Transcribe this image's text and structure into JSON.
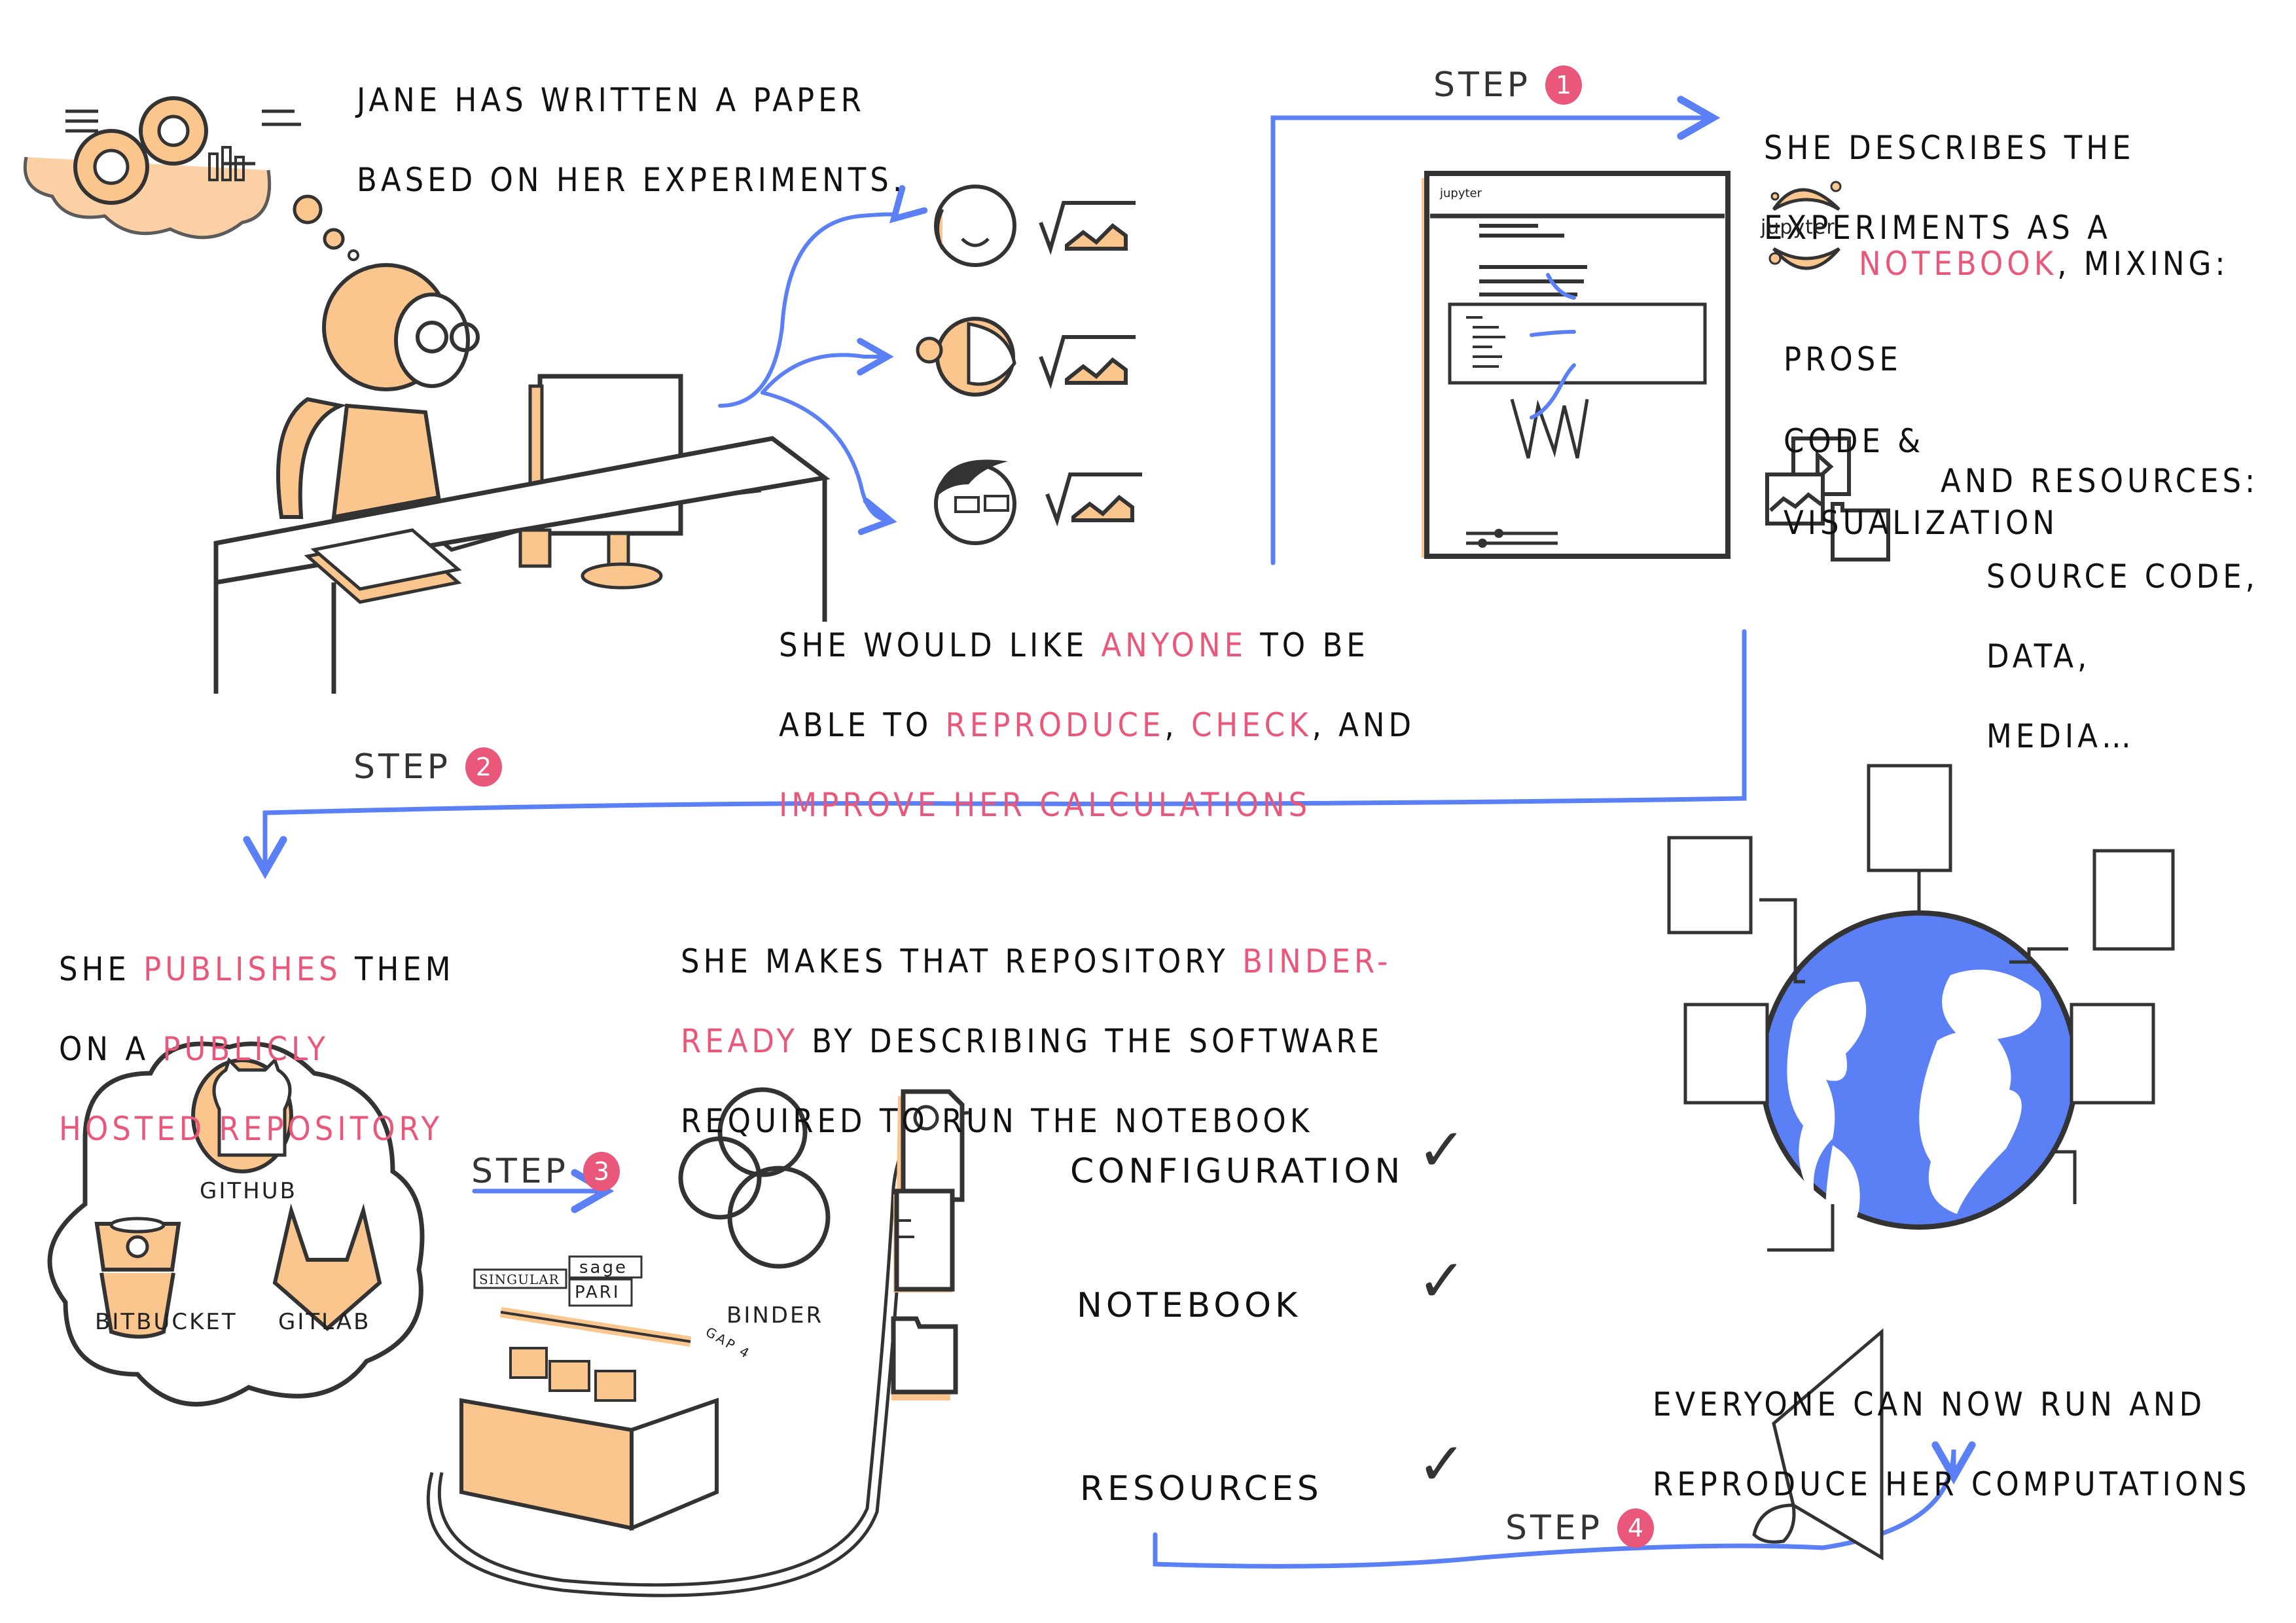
{
  "colors": {
    "accent_pink": "#e9577a",
    "arrow_blue": "#5b7ff5",
    "highlight_orange": "#fbc58e",
    "ink": "#333333",
    "globe_blue": "#5b7ff5"
  },
  "intro": {
    "line1": "JANE HAS WRITTEN A PAPER",
    "line2": "BASED ON HER EXPERIMENTS."
  },
  "goal": {
    "l1_a": "SHE WOULD LIKE ",
    "l1_b": "ANYONE",
    "l1_c": " TO BE",
    "l2_a": "ABLE TO ",
    "l2_b": "REPRODUCE",
    "l2_c": ", ",
    "l2_d": "CHECK",
    "l2_e": ", AND",
    "l3": "IMPROVE HER CALCULATIONS"
  },
  "steps": [
    {
      "label": "STEP",
      "number": "1"
    },
    {
      "label": "STEP",
      "number": "2"
    },
    {
      "label": "STEP",
      "number": "3"
    },
    {
      "label": "STEP",
      "number": "4"
    }
  ],
  "step1": {
    "line1": "SHE DESCRIBES THE",
    "line2": "EXPERIMENTS AS A",
    "jupyter_logo": "jupyter",
    "notebook": "NOTEBOOK",
    "mixing": ", MIXING:",
    "parts": [
      "PROSE",
      "CODE &",
      "VISUALIZATION"
    ],
    "resources_head": "AND RESOURCES:",
    "resources": [
      "SOURCE CODE,",
      "DATA,",
      "MEDIA…"
    ],
    "notebook_header": "jupyter"
  },
  "step2": {
    "l1_a": "SHE ",
    "l1_b": "PUBLISHES",
    "l1_c": " THEM",
    "l2_a": "ON A ",
    "l2_b": "PUBLICLY",
    "l3": "HOSTED REPOSITORY",
    "hosts": [
      "GITHUB",
      "BITBUCKET",
      "GITLAB"
    ]
  },
  "step3": {
    "l1_a": "SHE MAKES THAT REPOSITORY ",
    "l1_b": "BINDER-",
    "l2_a": "READY",
    "l2_b": " BY DESCRIBING THE SOFTWARE",
    "l3": "REQUIRED TO RUN THE NOTEBOOK",
    "binder_label": "BINDER",
    "toolbox_signs": [
      "SINGULAR",
      "sage",
      "PARI",
      "GAP 4"
    ],
    "checklist": [
      {
        "label": "CONFIGURATION",
        "icon": "config-file-icon",
        "checked": true
      },
      {
        "label": "NOTEBOOK",
        "icon": "notebook-icon",
        "checked": true
      },
      {
        "label": "RESOURCES",
        "icon": "folder-braces-icon",
        "checked": true
      }
    ],
    "check_glyph": "✓"
  },
  "result": {
    "line1": "EVERYONE CAN NOW RUN AND",
    "line2": "REPRODUCE HER COMPUTATIONS"
  }
}
